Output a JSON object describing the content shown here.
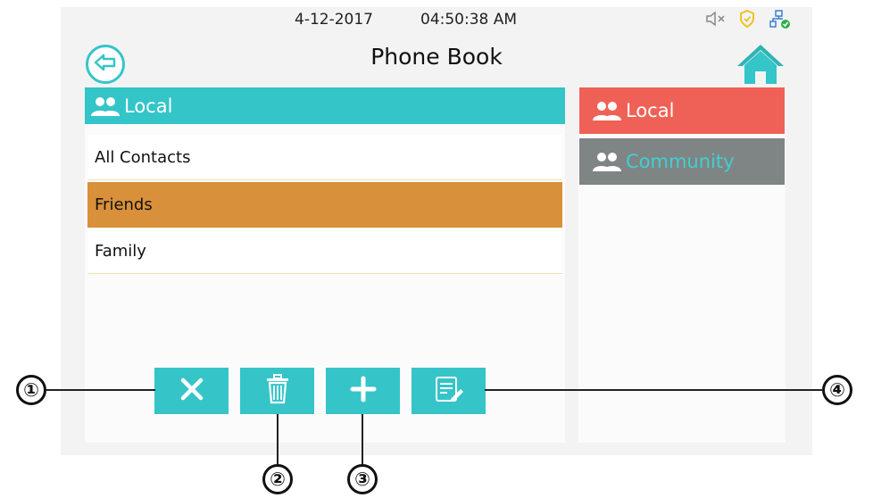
{
  "status": {
    "date": "4-12-2017",
    "time": "04:50:38  AM",
    "icons": [
      "mute-icon",
      "shield-icon",
      "network-icon"
    ]
  },
  "header": {
    "title": "Phone Book",
    "back_icon": "back-arrow-icon",
    "home_icon": "home-icon"
  },
  "left": {
    "group_label": "Local",
    "items": [
      {
        "label": "All Contacts",
        "selected": false
      },
      {
        "label": "Friends",
        "selected": true
      },
      {
        "label": "Family",
        "selected": false
      }
    ]
  },
  "right": {
    "buttons": [
      {
        "label": "Local",
        "color": "#ef6156"
      },
      {
        "label": "Community",
        "color": "#7f8585"
      }
    ]
  },
  "toolbar": {
    "buttons": [
      "close-icon",
      "trash-icon",
      "plus-icon",
      "edit-icon"
    ]
  },
  "callouts": [
    "①",
    "②",
    "③",
    "④"
  ],
  "colors": {
    "accent": "#35c5c8",
    "selected": "#d9903a",
    "local": "#ef6156",
    "community": "#7f8585"
  }
}
